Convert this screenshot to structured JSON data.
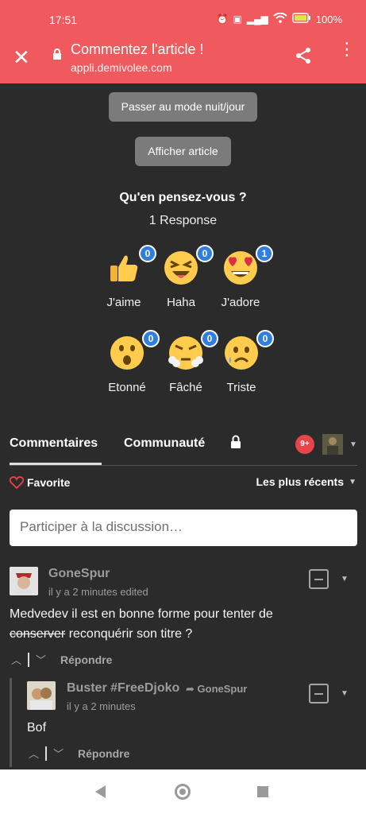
{
  "statusbar": {
    "time": "17:51",
    "battery": "100%"
  },
  "urlbar": {
    "title": "Commentez l'article !",
    "domain": "appli.demivolee.com"
  },
  "buttons": {
    "night_mode": "Passer au mode nuit/jour",
    "show_article": "Afficher article"
  },
  "reactions": {
    "question": "Qu'en pensez-vous ?",
    "responses": "1 Response",
    "items": [
      {
        "label": "J'aime",
        "count": "0",
        "icon": "thumbs-up-emoji"
      },
      {
        "label": "Haha",
        "count": "0",
        "icon": "laughing-emoji"
      },
      {
        "label": "J'adore",
        "count": "1",
        "icon": "heart-eyes-emoji"
      },
      {
        "label": "Etonné",
        "count": "0",
        "icon": "surprised-emoji"
      },
      {
        "label": "Fâché",
        "count": "0",
        "icon": "angry-emoji"
      },
      {
        "label": "Triste",
        "count": "0",
        "icon": "sad-emoji"
      }
    ]
  },
  "tabs": {
    "comments": "Commentaires",
    "community": "Communauté",
    "notifications": "9+"
  },
  "toolbar": {
    "favorite": "Favorite",
    "sort": "Les plus récents"
  },
  "composer": {
    "placeholder": "Participer à la discussion…"
  },
  "comments": [
    {
      "author": "GoneSpur",
      "meta": "il y a 2 minutes edited",
      "text_prefix": "Medvedev il est en bonne forme pour tenter de",
      "text_struck": "conserver",
      "text_suffix": " reconquérir son titre ?",
      "reply": "Répondre"
    },
    {
      "author": "Buster #FreeDjoko",
      "in_reply_to": "GoneSpur",
      "meta": "il y a 2 minutes",
      "text": "Bof",
      "reply": "Répondre"
    }
  ],
  "colors": {
    "header": "#f05a5e",
    "background": "#2b2b2b",
    "badge": "#2f7ee0",
    "notif": "#e8454b"
  }
}
